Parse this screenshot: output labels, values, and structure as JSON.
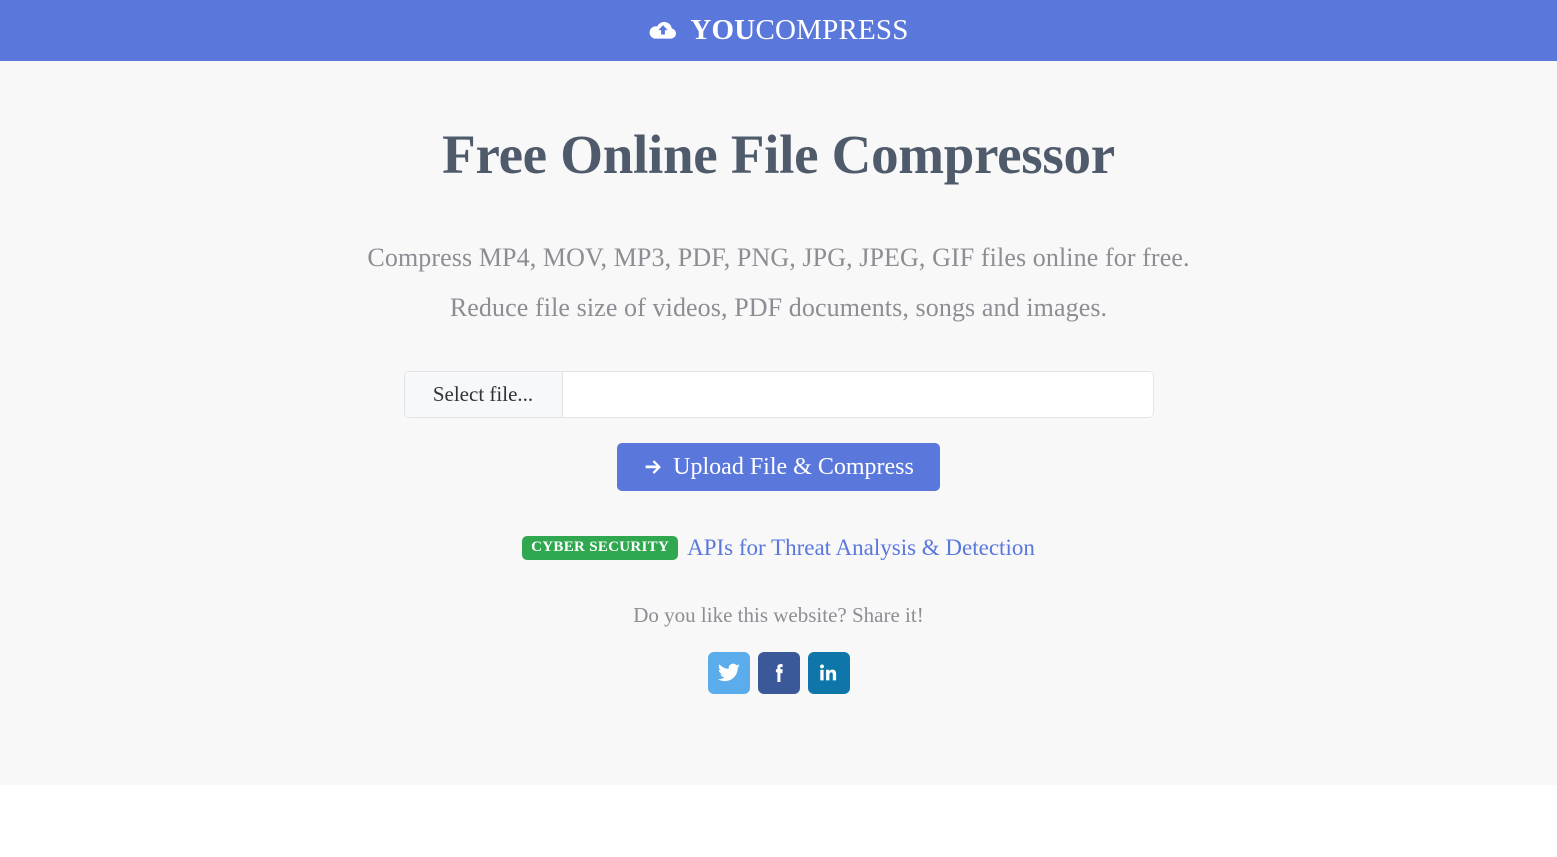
{
  "header": {
    "logo_icon": "cloud-upload-icon",
    "brand_bold": "YOU",
    "brand_light": "COMPRESS",
    "background_color": "#5a77dc"
  },
  "hero": {
    "title": "Free Online File Compressor",
    "subtitle_line1": "Compress MP4, MOV, MP3, PDF, PNG, JPG, JPEG, GIF files online for free.",
    "subtitle_line2": "Reduce file size of videos, PDF documents, songs and images.",
    "background_color": "#f8f8f9",
    "title_color": "#4f5b6b",
    "subtitle_color": "#8d8d93"
  },
  "upload_form": {
    "select_file_label": "Select file...",
    "file_name_value": "",
    "file_name_placeholder": "",
    "submit_label": "Upload File & Compress",
    "submit_icon": "arrow-right-icon",
    "submit_color": "#5a77dc"
  },
  "promo": {
    "badge_label": "CYBER SECURITY",
    "badge_color": "#2fa84f",
    "link_label": "APIs for Threat Analysis & Detection",
    "link_color": "#5a77dc"
  },
  "share": {
    "prompt": "Do you like this website? Share it!",
    "buttons": [
      {
        "name": "twitter",
        "icon": "twitter-icon",
        "color": "#5bacea"
      },
      {
        "name": "facebook",
        "icon": "facebook-icon",
        "color": "#3b5998"
      },
      {
        "name": "linkedin",
        "icon": "linkedin-icon",
        "color": "#0e76a8"
      }
    ]
  }
}
